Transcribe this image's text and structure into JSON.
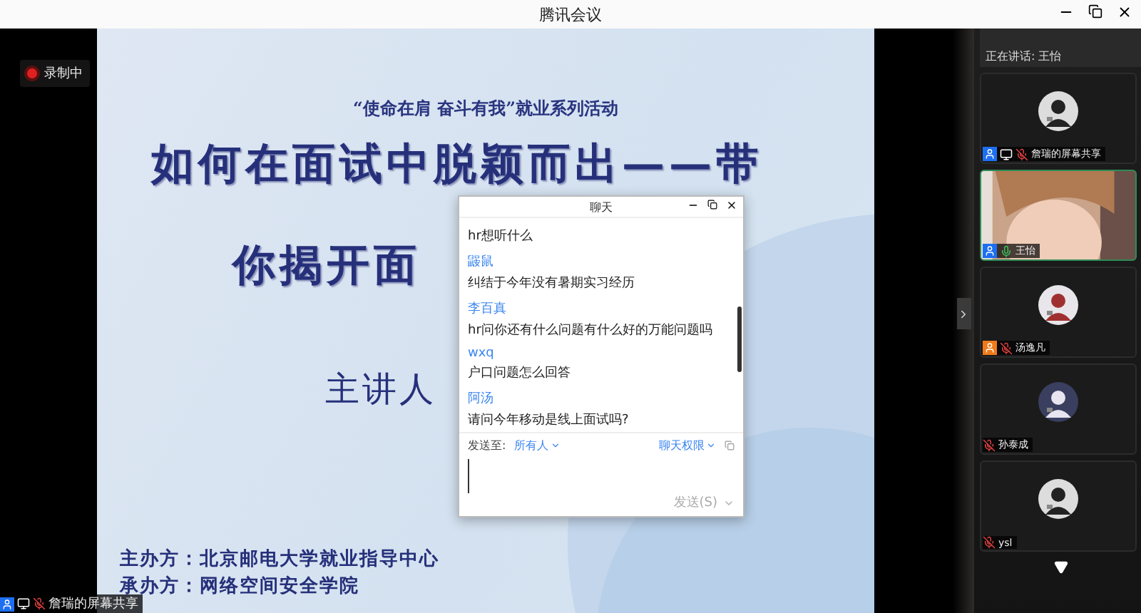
{
  "window": {
    "title": "腾讯会议"
  },
  "recording": {
    "label": "录制中"
  },
  "slide": {
    "subtitle": "“使命在肩 奋斗有我”就业系列活动",
    "title_lines": [
      "如何在面试中脱颖而出——带",
      "你揭开面"
    ],
    "speaker_label": "主讲人",
    "organizers": [
      "主办方：北京邮电大学就业指导中心",
      "承办方：网络空间安全学院"
    ]
  },
  "chat": {
    "title": "聊天",
    "messages": [
      {
        "text": "hr想听什么"
      },
      {
        "sender": "鼹鼠",
        "text": "纠结于今年没有暑期实习经历"
      },
      {
        "sender": "李百真",
        "text": "hr问你还有什么问题有什么好的万能问题吗"
      },
      {
        "sender": "wxq",
        "text": "户口问题怎么回答"
      },
      {
        "sender": "阿汤",
        "text": "请问今年移动是线上面试吗?"
      }
    ],
    "send_to_label": "发送至:",
    "recipient": "所有人",
    "permissions": "聊天权限",
    "send_button": "发送(S)"
  },
  "participants": {
    "speaking": "正在讲话: 王怡",
    "tiles": [
      {
        "name": "詹瑞的屏幕共享",
        "kind": "avatar",
        "color": "#1d6ff2",
        "sharing": true,
        "mic_muted": true,
        "speaking": false
      },
      {
        "name": "王怡",
        "kind": "video",
        "color": "#1d6ff2",
        "sharing": false,
        "mic_muted": false,
        "speaking": true
      },
      {
        "name": "汤逸凡",
        "kind": "avatar",
        "color": "#f07a1a",
        "sharing": false,
        "mic_muted": true,
        "speaking": false
      },
      {
        "name": "孙泰成",
        "kind": "avatar",
        "sharing": false,
        "mic_muted": true,
        "speaking": false
      },
      {
        "name": "ysl",
        "kind": "avatar",
        "sharing": false,
        "mic_muted": true,
        "speaking": false
      }
    ]
  },
  "share_bar": {
    "name": "詹瑞的屏幕共享"
  }
}
